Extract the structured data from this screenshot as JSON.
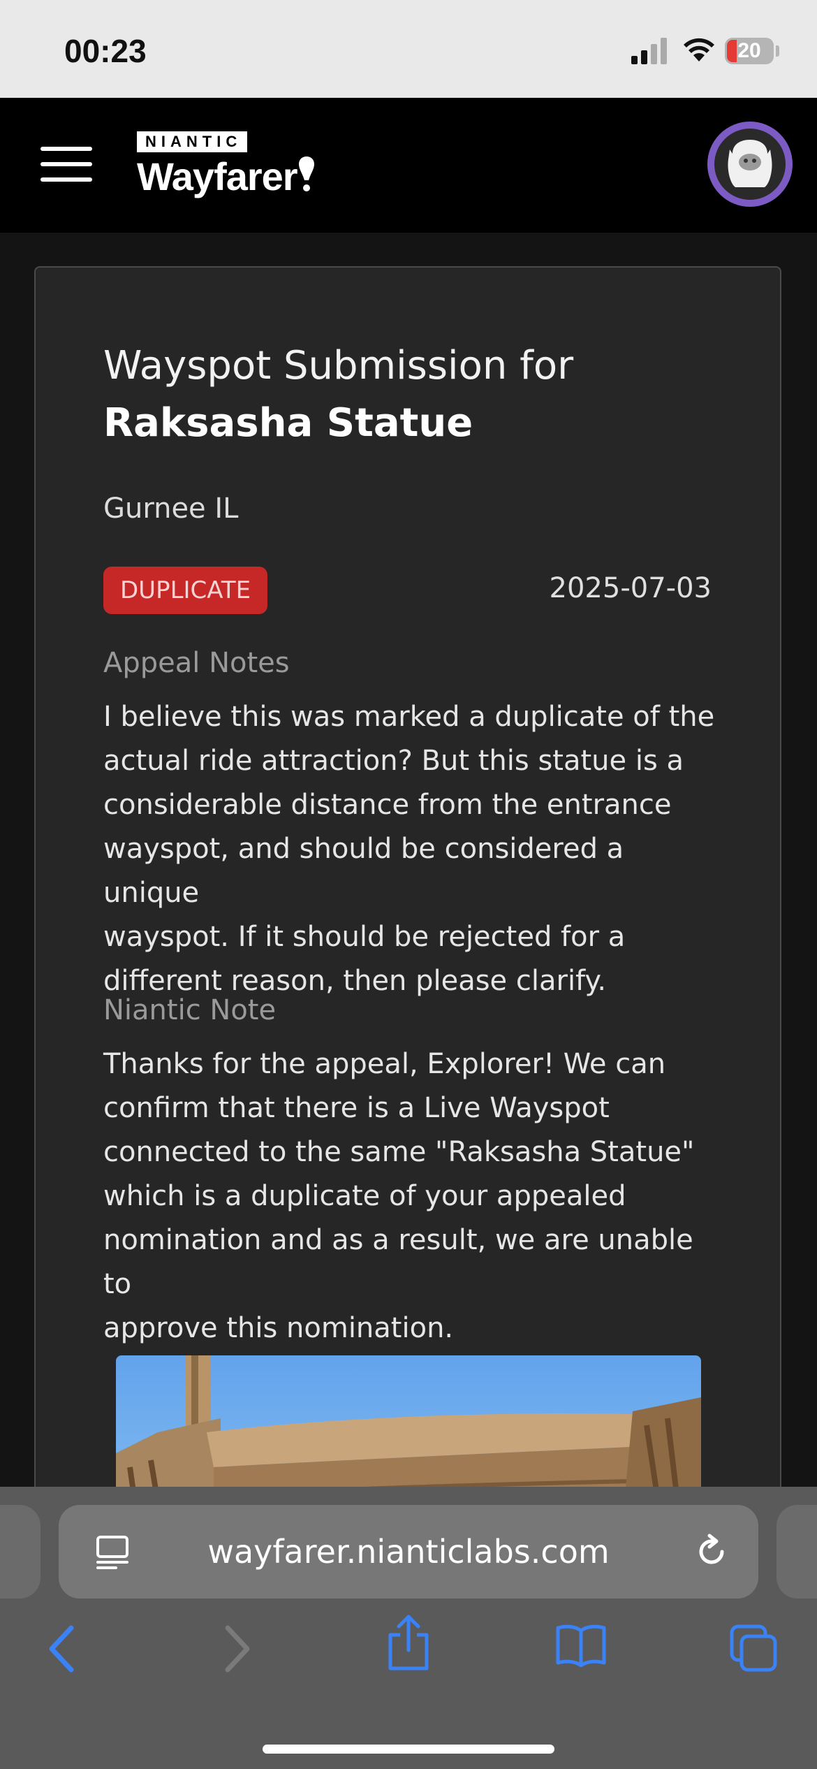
{
  "status_bar": {
    "time": "00:23",
    "battery": "20"
  },
  "header": {
    "logo_small": "NIANTIC",
    "logo_large": "Wayfarer"
  },
  "card": {
    "title_prefix": "Wayspot Submission for",
    "title_name": "Raksasha Statue",
    "location": "Gurnee IL",
    "status": "DUPLICATE",
    "date": "2025-07-03",
    "appeal_label": "Appeal Notes",
    "appeal_lines": [
      "I believe this was marked a duplicate of the",
      "actual ride attraction? But this statue is a",
      "considerable distance from the entrance",
      "wayspot, and should be considered a unique",
      "wayspot. If it should be rejected for a",
      "different reason, then please clarify."
    ],
    "niantic_label": "Niantic Note",
    "niantic_lines": [
      "Thanks for the appeal, Explorer! We can",
      "confirm that there is a Live Wayspot",
      "connected to the same \"Raksasha Statue\"",
      "which is a duplicate of your appealed",
      "nomination and as a result, we are unable to",
      "approve this nomination."
    ]
  },
  "browser": {
    "url": "wayfarer.nianticlabs.com"
  },
  "colors": {
    "badge": "#c62828",
    "accent": "#3b82f6",
    "avatar_ring": "#7c5cc4"
  }
}
